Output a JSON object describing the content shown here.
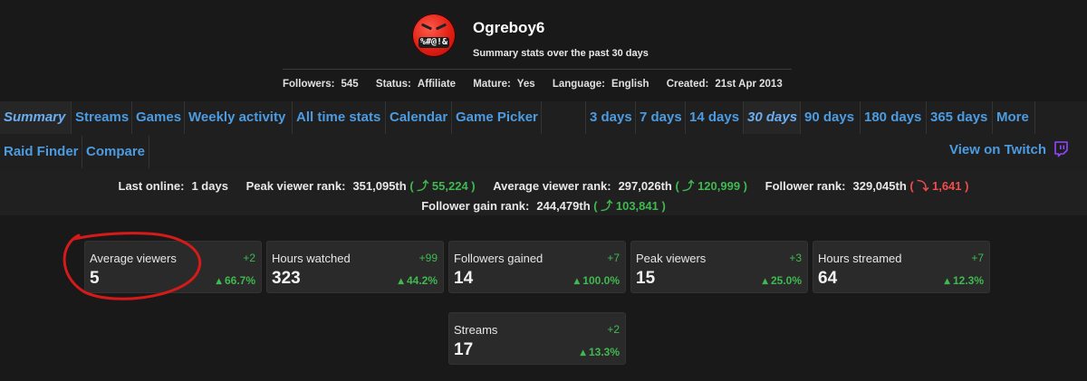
{
  "profile": {
    "username": "Ogreboy6",
    "subtitle": "Summary stats over the past 30 days",
    "avatar_text": "%#@!&",
    "meta": [
      {
        "label": "Followers:",
        "value": "545"
      },
      {
        "label": "Status:",
        "value": "Affiliate"
      },
      {
        "label": "Mature:",
        "value": "Yes"
      },
      {
        "label": "Language:",
        "value": "English"
      },
      {
        "label": "Created:",
        "value": "21st Apr 2013"
      }
    ]
  },
  "nav": {
    "main_tabs": [
      "Summary",
      "Streams",
      "Games",
      "Weekly activity",
      "All time stats",
      "Calendar",
      "Game Picker"
    ],
    "range_tabs": [
      "3 days",
      "7 days",
      "14 days",
      "30 days",
      "90 days",
      "180 days",
      "365 days",
      "More"
    ],
    "second_row_tabs": [
      "Raid Finder",
      "Compare"
    ],
    "twitch_link": "View on Twitch",
    "active_main": "Summary",
    "active_range": "30 days"
  },
  "ranks": {
    "last_online_label": "Last online:",
    "last_online_value": "1 days",
    "peak_label": "Peak viewer rank:",
    "peak_value": "351,095th",
    "peak_change": "55,224",
    "avg_label": "Average viewer rank:",
    "avg_value": "297,026th",
    "avg_change": "120,999",
    "follower_label": "Follower rank:",
    "follower_value": "329,045th",
    "follower_change": "1,641",
    "gain_label": "Follower gain rank:",
    "gain_value": "244,479th",
    "gain_change": "103,841"
  },
  "cards": [
    {
      "label": "Average viewers",
      "delta": "+2",
      "value": "5",
      "pct": "66.7%"
    },
    {
      "label": "Hours watched",
      "delta": "+99",
      "value": "323",
      "pct": "44.2%"
    },
    {
      "label": "Followers gained",
      "delta": "+7",
      "value": "14",
      "pct": "100.0%"
    },
    {
      "label": "Peak viewers",
      "delta": "+3",
      "value": "15",
      "pct": "25.0%"
    },
    {
      "label": "Hours streamed",
      "delta": "+7",
      "value": "64",
      "pct": "12.3%"
    },
    {
      "label": "Streams",
      "delta": "+2",
      "value": "17",
      "pct": "13.3%"
    }
  ],
  "colors": {
    "accent": "#4d9be0",
    "positive": "#3fb950",
    "negative": "#f14c4c",
    "annotation": "#d61a1a",
    "twitch": "#9146ff"
  }
}
